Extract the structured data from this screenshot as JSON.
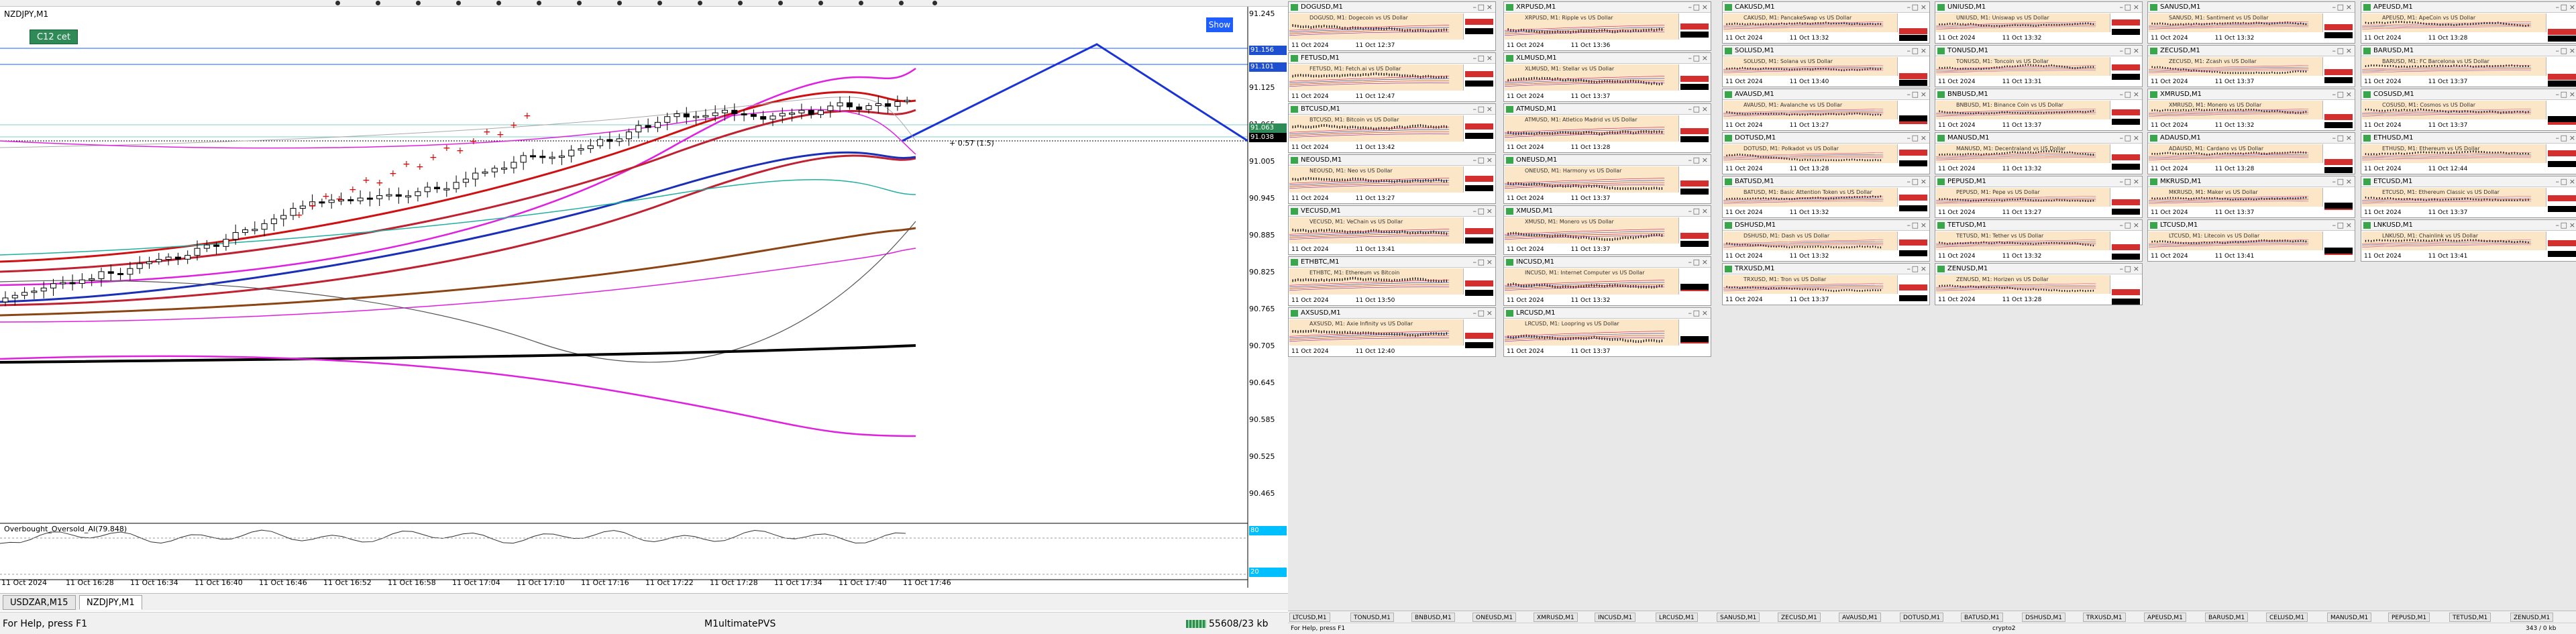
{
  "main": {
    "title": "NZDJPY,M1",
    "button_c12": "C12 cet",
    "button_show": "Show",
    "trade_label": "+ 0.57 (1.5)",
    "price_labels": [
      "91.245",
      "91.185",
      "91.125",
      "91.065",
      "91.005",
      "90.945",
      "90.885",
      "90.825",
      "90.765",
      "90.705",
      "90.645",
      "90.585",
      "90.525",
      "90.465",
      "90.405"
    ],
    "price_tags": [
      {
        "text": "91.156",
        "color": "#1f4fd1"
      },
      {
        "text": "91.101",
        "color": "#1f4fd1"
      },
      {
        "text": "91.063",
        "color": "#2e8b57"
      },
      {
        "text": "91.038",
        "color": "#000000"
      }
    ],
    "time_labels": [
      "11 Oct 2024",
      "11 Oct 16:28",
      "11 Oct 16:34",
      "11 Oct 16:40",
      "11 Oct 16:46",
      "11 Oct 16:52",
      "11 Oct 16:58",
      "11 Oct 17:04",
      "11 Oct 17:10",
      "11 Oct 17:16",
      "11 Oct 17:22",
      "11 Oct 17:28",
      "11 Oct 17:34",
      "11 Oct 17:40",
      "11 Oct 17:46"
    ],
    "oscillator_title": "Overbought_Oversold_AI(79.848)",
    "osc_levels": [
      "80",
      "20"
    ]
  },
  "bottom_tabs": [
    "USDZAR,M15",
    "NZDJPY,M1"
  ],
  "status": {
    "help": "For Help, press F1",
    "profile": "M1ultimatePVS",
    "traffic": "55608/23 kb"
  },
  "minis": [
    {
      "sym": "DOGUSD,M1",
      "desc": "DOGUSD, M1: Dogecoin vs US Dollar",
      "d1": "11 Oct 2024",
      "d2": "11 Oct 12:37"
    },
    {
      "sym": "XRPUSD,M1",
      "desc": "XRPUSD, M1: Ripple vs US Dollar",
      "d1": "11 Oct 2024",
      "d2": "11 Oct 13:36"
    },
    {
      "sym": "CAKUSD,M1",
      "desc": "CAKUSD, M1: PancakeSwap vs US Dollar",
      "d1": "11 Oct 2024",
      "d2": "11 Oct 13:32"
    },
    {
      "sym": "UNIUSD,M1",
      "desc": "UNIUSD, M1: Uniswap vs US Dollar",
      "d1": "11 Oct 2024",
      "d2": "11 Oct 13:32"
    },
    {
      "sym": "SANUSD,M1",
      "desc": "SANUSD, M1: Santiment vs US Dollar",
      "d1": "11 Oct 2024",
      "d2": "11 Oct 13:32"
    },
    {
      "sym": "APEUSD,M1",
      "desc": "APEUSD, M1: ApeCoin vs US Dollar",
      "d1": "11 Oct 2024",
      "d2": "11 Oct 13:28"
    },
    {
      "sym": "FETUSD,M1",
      "desc": "FETUSD, M1: Fetch.ai vs US Dollar",
      "d1": "11 Oct 2024",
      "d2": "11 Oct 12:47"
    },
    {
      "sym": "XLMUSD,M1",
      "desc": "XLMUSD, M1: Stellar vs US Dollar",
      "d1": "11 Oct 2024",
      "d2": "11 Oct 13:37"
    },
    {
      "sym": "SOLUSD,M1",
      "desc": "SOLUSD, M1: Solana vs US Dollar",
      "d1": "11 Oct 2024",
      "d2": "11 Oct 13:40"
    },
    {
      "sym": "TONUSD,M1",
      "desc": "TONUSD, M1: Toncoin vs US Dollar",
      "d1": "11 Oct 2024",
      "d2": "11 Oct 13:31"
    },
    {
      "sym": "ZECUSD,M1",
      "desc": "ZECUSD, M1: Zcash vs US Dollar",
      "d1": "11 Oct 2024",
      "d2": "11 Oct 13:37"
    },
    {
      "sym": "BARUSD,M1",
      "desc": "BARUSD, M1: FC Barcelona vs US Dollar",
      "d1": "11 Oct 2024",
      "d2": "11 Oct 13:37"
    },
    {
      "sym": "BTCUSD,M1",
      "desc": "BTCUSD, M1: Bitcoin vs US Dollar",
      "d1": "11 Oct 2024",
      "d2": "11 Oct 13:42"
    },
    {
      "sym": "ATMUSD,M1",
      "desc": "ATMUSD, M1: Atletico Madrid vs US Dollar",
      "d1": "11 Oct 2024",
      "d2": "11 Oct 13:28"
    },
    {
      "sym": "AVAUSD,M1",
      "desc": "AVAUSD, M1: Avalanche vs US Dollar",
      "d1": "11 Oct 2024",
      "d2": "11 Oct 13:27"
    },
    {
      "sym": "BNBUSD,M1",
      "desc": "BNBUSD, M1: Binance Coin vs US Dollar",
      "d1": "11 Oct 2024",
      "d2": "11 Oct 13:37"
    },
    {
      "sym": "XMRUSD,M1",
      "desc": "XMRUSD, M1: Monero vs US Dollar",
      "d1": "11 Oct 2024",
      "d2": "11 Oct 13:32"
    },
    {
      "sym": "COSUSD,M1",
      "desc": "COSUSD, M1: Cosmos vs US Dollar",
      "d1": "11 Oct 2024",
      "d2": "11 Oct 13:37"
    },
    {
      "sym": "NEOUSD,M1",
      "desc": "NEOUSD, M1: Neo vs US Dollar",
      "d1": "11 Oct 2024",
      "d2": "11 Oct 13:27"
    },
    {
      "sym": "ONEUSD,M1",
      "desc": "ONEUSD, M1: Harmony vs US Dollar",
      "d1": "11 Oct 2024",
      "d2": "11 Oct 13:37"
    },
    {
      "sym": "DOTUSD,M1",
      "desc": "DOTUSD, M1: Polkadot vs US Dollar",
      "d1": "11 Oct 2024",
      "d2": "11 Oct 13:28"
    },
    {
      "sym": "MANUSD,M1",
      "desc": "MANUSD, M1: Decentraland vs US Dollar",
      "d1": "11 Oct 2024",
      "d2": "11 Oct 13:32"
    },
    {
      "sym": "ADAUSD,M1",
      "desc": "ADAUSD, M1: Cardano vs US Dollar",
      "d1": "11 Oct 2024",
      "d2": "11 Oct 13:28"
    },
    {
      "sym": "ETHUSD,M1",
      "desc": "ETHUSD, M1: Ethereum vs US Dollar",
      "d1": "11 Oct 2024",
      "d2": "11 Oct 12:44"
    },
    {
      "sym": "VECUSD,M1",
      "desc": "VECUSD, M1: VeChain vs US Dollar",
      "d1": "11 Oct 2024",
      "d2": "11 Oct 13:41"
    },
    {
      "sym": "XMUSD,M1",
      "desc": "XMUSD, M1: Monero vs US Dollar",
      "d1": "11 Oct 2024",
      "d2": "11 Oct 13:37"
    },
    {
      "sym": "BATUSD,M1",
      "desc": "BATUSD, M1: Basic Attention Token vs US Dollar",
      "d1": "11 Oct 2024",
      "d2": "11 Oct 13:32"
    },
    {
      "sym": "PEPUSD,M1",
      "desc": "PEPUSD, M1: Pepe vs US Dollar",
      "d1": "11 Oct 2024",
      "d2": "11 Oct 13:27"
    },
    {
      "sym": "MKRUSD,M1",
      "desc": "MKRUSD, M1: Maker vs US Dollar",
      "d1": "11 Oct 2024",
      "d2": "11 Oct 13:37"
    },
    {
      "sym": "ETCUSD,M1",
      "desc": "ETCUSD, M1: Ethereum Classic vs US Dollar",
      "d1": "11 Oct 2024",
      "d2": "11 Oct 13:37"
    },
    {
      "sym": "ETHBTC,M1",
      "desc": "ETHBTC, M1: Ethereum vs Bitcoin",
      "d1": "11 Oct 2024",
      "d2": "11 Oct 13:50"
    },
    {
      "sym": "INCUSD,M1",
      "desc": "INCUSD, M1: Internet Computer vs US Dollar",
      "d1": "11 Oct 2024",
      "d2": "11 Oct 13:32"
    },
    {
      "sym": "DSHUSD,M1",
      "desc": "DSHUSD, M1: Dash vs US Dollar",
      "d1": "11 Oct 2024",
      "d2": "11 Oct 13:32"
    },
    {
      "sym": "TETUSD,M1",
      "desc": "TETUSD, M1: Tether vs US Dollar",
      "d1": "11 Oct 2024",
      "d2": "11 Oct 13:32"
    },
    {
      "sym": "LTCUSD,M1",
      "desc": "LTCUSD, M1: Litecoin vs US Dollar",
      "d1": "11 Oct 2024",
      "d2": "11 Oct 13:41"
    },
    {
      "sym": "LNKUSD,M1",
      "desc": "LNKUSD, M1: Chainlink vs US Dollar",
      "d1": "11 Oct 2024",
      "d2": "11 Oct 13:41"
    },
    {
      "sym": "AXSUSD,M1",
      "desc": "AXSUSD, M1: Axie Infinity vs US Dollar",
      "d1": "11 Oct 2024",
      "d2": "11 Oct 12:40"
    },
    {
      "sym": "LRCUSD,M1",
      "desc": "LRCUSD, M1: Loopring vs US Dollar",
      "d1": "11 Oct 2024",
      "d2": "11 Oct 13:37"
    },
    {
      "sym": "TRXUSD,M1",
      "desc": "TRXUSD, M1: Tron vs US Dollar",
      "d1": "11 Oct 2024",
      "d2": "11 Oct 13:37"
    },
    {
      "sym": "ZENUSD,M1",
      "desc": "ZENUSD, M1: Horizen vs US Dollar",
      "d1": "11 Oct 2024",
      "d2": "11 Oct 13:28"
    }
  ],
  "grid_tabs": [
    "LTCUSD,M1",
    "TONUSD,M1",
    "BNBUSD,M1",
    "ONEUSD,M1",
    "XMRUSD,M1",
    "INCUSD,M1",
    "LRCUSD,M1",
    "SANUSD,M1",
    "ZECUSD,M1",
    "AVAUSD,M1",
    "DOTUSD,M1",
    "BATUSD,M1",
    "DSHUSD,M1",
    "TRXUSD,M1",
    "APEUSD,M1",
    "BARUSD,M1",
    "CELUSD,M1",
    "MANUSD,M1",
    "PEPUSD,M1",
    "TETUSD,M1",
    "ZENUSD,M1"
  ],
  "grid_status": {
    "help": "For Help, press F1",
    "profile": "crypto2",
    "traffic": "343 / 0 kb"
  }
}
